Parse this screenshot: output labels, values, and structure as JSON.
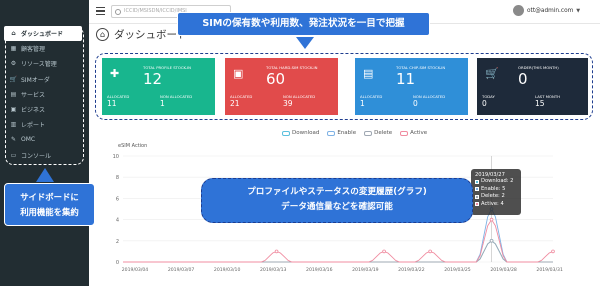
{
  "topbar": {
    "search_placeholder": "ICCID/MSISDN/ICCID/IMSI",
    "user_email": "ott@admin.com"
  },
  "sidebar": {
    "items": [
      {
        "label": "ダッシュボード",
        "icon": "home-icon",
        "active": true
      },
      {
        "label": "顧客管理",
        "icon": "table-icon",
        "active": false
      },
      {
        "label": "リソース管理",
        "icon": "resource-icon",
        "active": false
      },
      {
        "label": "SIMオーダ",
        "icon": "cart-icon",
        "active": false
      },
      {
        "label": "サービス",
        "icon": "service-icon",
        "active": false
      },
      {
        "label": "ビジネス",
        "icon": "briefcase-icon",
        "active": false
      },
      {
        "label": "レポート",
        "icon": "report-icon",
        "active": false
      },
      {
        "label": "OMC",
        "icon": "omc-icon",
        "active": false
      },
      {
        "label": "コンソール",
        "icon": "console-icon",
        "active": false
      }
    ]
  },
  "page": {
    "title": "ダッシュボード"
  },
  "callouts": {
    "top": "SIMの保有数や利用数、発注状況を一目で把握",
    "side_line1": "サイドボードに",
    "side_line2": "利用機能を集約",
    "chart_line1": "プロファイルやステータスの変更履歴(グラフ)",
    "chart_line2": "データ通信量などを確認可能"
  },
  "cards": [
    {
      "label": "TOTAL PROFILE STOCK-IN",
      "value": "12",
      "sub1_label": "ALLOCATED",
      "sub1_value": "11",
      "sub2_label": "NON ALLOCATED",
      "sub2_value": "1",
      "color": "#18b68e",
      "icon": "puzzle-icon"
    },
    {
      "label": "TOTAL HARD-SIM STOCK-IN",
      "value": "60",
      "sub1_label": "ALLOCATED",
      "sub1_value": "21",
      "sub2_label": "NON ALLOCATED",
      "sub2_value": "39",
      "color": "#e14b4b",
      "icon": "sim-card-icon"
    },
    {
      "label": "TOTAL CHIP-SIM STOCK-IN",
      "value": "11",
      "sub1_label": "ALLOCATED",
      "sub1_value": "1",
      "sub2_label": "NON ALLOCATED",
      "sub2_value": "0",
      "color": "#2f8fd8",
      "icon": "chip-icon"
    },
    {
      "label": "ORDER(THIS MONTH)",
      "value": "0",
      "sub1_label": "TODAY",
      "sub1_value": "0",
      "sub2_label": "LAST MONTH",
      "sub2_value": "15",
      "color": "#1e2a3a",
      "icon": "cart-icon"
    }
  ],
  "tooltip": {
    "date": "2019/03/27",
    "rows": [
      {
        "label": "Download: 2",
        "color": "#5bc0de"
      },
      {
        "label": "Enable: 5",
        "color": "#7fb2e5"
      },
      {
        "label": "Delete: 2",
        "color": "#9fa8b3"
      },
      {
        "label": "Active: 4",
        "color": "#f08ca0"
      }
    ]
  },
  "chart_data": {
    "type": "line",
    "title": "eSIM Action",
    "x": [
      "2019/03/04",
      "2019/03/07",
      "2019/03/10",
      "2019/03/13",
      "2019/03/16",
      "2019/03/19",
      "2019/03/22",
      "2019/03/25",
      "2019/03/28",
      "2019/03/31"
    ],
    "ylim": [
      0,
      10
    ],
    "yticks": [
      0,
      2,
      4,
      6,
      8,
      10
    ],
    "legend_position": "top",
    "series": [
      {
        "name": "Download",
        "color": "#5bc0de",
        "points": [
          [
            24,
            2
          ]
        ]
      },
      {
        "name": "Enable",
        "color": "#7fb2e5",
        "points": [
          [
            24,
            5
          ]
        ]
      },
      {
        "name": "Delete",
        "color": "#9fa8b3",
        "points": [
          [
            24,
            2
          ]
        ]
      },
      {
        "name": "Active",
        "color": "#f08ca0",
        "points": [
          [
            10,
            1
          ],
          [
            17,
            1
          ],
          [
            20,
            1
          ],
          [
            24,
            4
          ],
          [
            28,
            1
          ]
        ]
      }
    ]
  }
}
